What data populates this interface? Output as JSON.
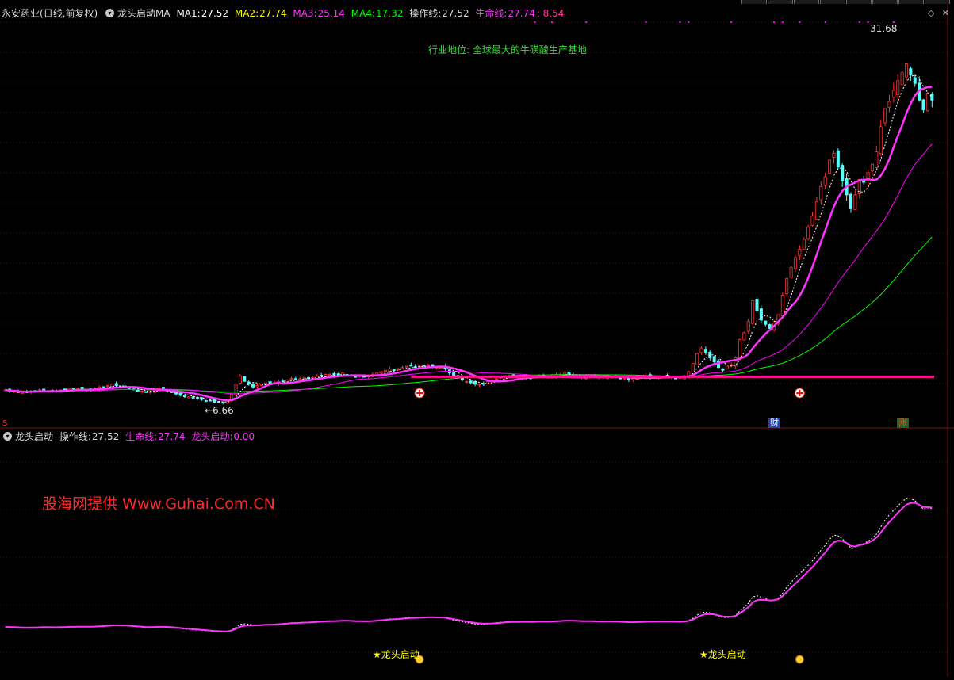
{
  "top_panel": {
    "stock_name": "永安药业",
    "period": "(日线,前复权)",
    "indicator": "龙头启动MA",
    "ma1_label": "MA1:",
    "ma1_value": "27.52",
    "ma2_label": "MA2:",
    "ma2_value": "27.74",
    "ma3_label": "MA3:",
    "ma3_value": "25.14",
    "ma4_label": "MA4:",
    "ma4_value": "17.32",
    "op_label": "操作线:",
    "op_value": "27.52",
    "life_label": "生命线:",
    "life_value": "27.74",
    "life_extra": ": 8.54",
    "industry_note": "行业地位: 全球最大的牛磺酸生产基地",
    "high_label": "31.68",
    "low_label": "6.66",
    "badge_cai": "财",
    "badge_zhang": "涨",
    "badge_s": "S"
  },
  "bottom_panel": {
    "indicator": "龙头启动",
    "op_label": "操作线:",
    "op_value": "27.52",
    "life_label": "生命线:",
    "life_value": "27.74",
    "signal_label": "龙头启动:",
    "signal_value": "0.00",
    "signal_text_1": "龙头启动",
    "signal_text_2": "龙头启动"
  },
  "watermark": "股海网提供 Www.Guhai.Com.CN",
  "colors": {
    "background": "#000000",
    "up_candle": "#ff3232",
    "down_candle": "#54ffff",
    "ma1": "#ffffff",
    "ma2": "#ffff00",
    "ma3": "#ff00ff",
    "ma4": "#00ff00",
    "life_line": "#ff33ff",
    "level_line": "#ff1493",
    "grid": "#3a1414"
  },
  "chart_data": {
    "type": "candlestick",
    "note_series": "approximate daily closes read from the chart; each bar is one trading day",
    "price_range": [
      6,
      34
    ],
    "key_levels": {
      "high": 31.68,
      "low": 6.66,
      "breakout_line": 8.54
    },
    "closes": [
      7.6,
      7.5,
      7.5,
      7.4,
      7.4,
      7.4,
      7.5,
      7.5,
      7.6,
      7.6,
      7.5,
      7.5,
      7.5,
      7.6,
      7.6,
      7.7,
      7.6,
      7.7,
      7.6,
      7.6,
      7.6,
      7.7,
      7.8,
      7.8,
      7.9,
      8.0,
      7.9,
      7.8,
      7.8,
      7.7,
      7.6,
      7.5,
      7.5,
      7.4,
      7.5,
      7.6,
      7.7,
      7.6,
      7.5,
      7.4,
      7.3,
      7.2,
      7.1,
      7.1,
      7.0,
      7.0,
      6.9,
      6.8,
      6.8,
      6.7,
      6.7,
      6.66,
      6.8,
      7.3,
      8.0,
      8.6,
      8.2,
      8.0,
      7.8,
      7.9,
      8.0,
      8.1,
      8.0,
      8.1,
      8.2,
      8.2,
      8.3,
      8.4,
      8.3,
      8.4,
      8.5,
      8.4,
      8.5,
      8.6,
      8.6,
      8.7,
      8.7,
      8.6,
      8.7,
      8.8,
      8.6,
      8.6,
      8.5,
      8.6,
      8.5,
      8.6,
      8.7,
      8.8,
      8.9,
      9.0,
      9.1,
      9.0,
      9.1,
      9.2,
      9.3,
      9.3,
      9.2,
      9.3,
      9.3,
      9.4,
      9.3,
      9.2,
      9.2,
      9.1,
      8.8,
      8.6,
      8.5,
      8.3,
      8.2,
      8.1,
      8.0,
      8.0,
      8.0,
      8.2,
      8.3,
      8.4,
      8.5,
      8.5,
      8.6,
      8.5,
      8.5,
      8.5,
      8.5,
      8.4,
      8.5,
      8.6,
      8.5,
      8.5,
      8.6,
      8.7,
      8.7,
      8.8,
      8.7,
      8.6,
      8.6,
      8.5,
      8.6,
      8.6,
      8.5,
      8.5,
      8.5,
      8.6,
      8.5,
      8.5,
      8.4,
      8.4,
      8.3,
      8.4,
      8.5,
      8.5,
      8.6,
      8.5,
      8.5,
      8.6,
      8.5,
      8.6,
      8.5,
      8.4,
      8.5,
      8.6,
      8.9,
      9.5,
      10.2,
      10.6,
      10.3,
      9.9,
      9.6,
      9.2,
      9.0,
      9.3,
      9.4,
      9.9,
      11.2,
      11.7,
      12.5,
      14.0,
      13.3,
      12.6,
      12.3,
      12.0,
      12.4,
      13.0,
      14.4,
      15.6,
      16.4,
      17.1,
      17.7,
      18.4,
      19.3,
      20.1,
      21.1,
      22.2,
      22.9,
      24.1,
      24.6,
      23.6,
      22.6,
      21.6,
      20.6,
      21.6,
      22.7,
      22.5,
      23.2,
      23.8,
      24.7,
      26.5,
      27.8,
      28.3,
      29.1,
      29.8,
      30.4,
      31.0,
      30.2,
      29.6,
      28.4,
      27.7,
      28.9,
      28.4
    ],
    "ma_life_line": "magenta thick line, trending from ~7.5 to 27.74",
    "signals": [
      {
        "type": "龙头启动",
        "index": 97
      },
      {
        "type": "龙头启动",
        "index": 186
      }
    ],
    "bottom_range": [
      0,
      40
    ]
  }
}
